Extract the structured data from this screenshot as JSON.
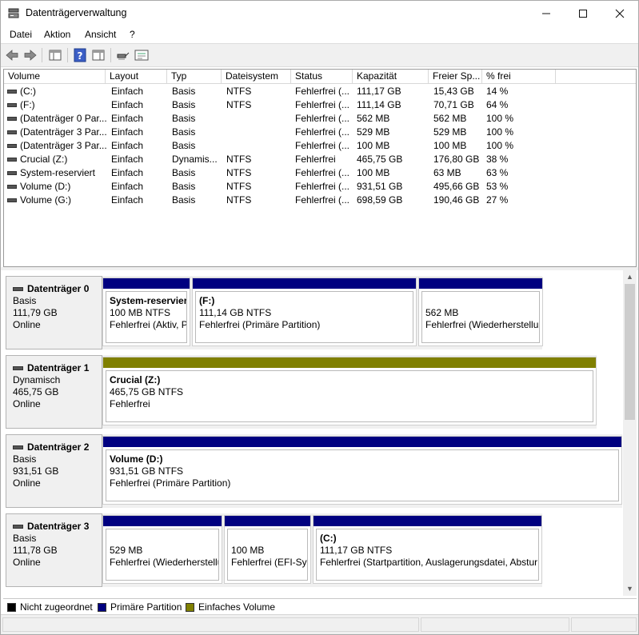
{
  "window": {
    "title": "Datenträgerverwaltung",
    "minimize": "—",
    "maximize": "☐",
    "close": "✕"
  },
  "menu": [
    "Datei",
    "Aktion",
    "Ansicht",
    "?"
  ],
  "toolbar": {
    "icons": [
      "back-arrow-icon",
      "forward-arrow-icon",
      "console-tree-icon",
      "help-icon",
      "details-pane-icon",
      "connect-icon",
      "properties-icon"
    ]
  },
  "volume_list": {
    "columns": [
      "Volume",
      "Layout",
      "Typ",
      "Dateisystem",
      "Status",
      "Kapazität",
      "Freier Sp...",
      "% frei"
    ],
    "rows": [
      [
        "(C:)",
        "Einfach",
        "Basis",
        "NTFS",
        "Fehlerfrei (...",
        "111,17 GB",
        "15,43 GB",
        "14 %"
      ],
      [
        "(F:)",
        "Einfach",
        "Basis",
        "NTFS",
        "Fehlerfrei (...",
        "111,14 GB",
        "70,71 GB",
        "64 %"
      ],
      [
        "(Datenträger 0 Par...",
        "Einfach",
        "Basis",
        "",
        "Fehlerfrei (...",
        "562 MB",
        "562 MB",
        "100 %"
      ],
      [
        "(Datenträger 3 Par...",
        "Einfach",
        "Basis",
        "",
        "Fehlerfrei (...",
        "529 MB",
        "529 MB",
        "100 %"
      ],
      [
        "(Datenträger 3 Par...",
        "Einfach",
        "Basis",
        "",
        "Fehlerfrei (...",
        "100 MB",
        "100 MB",
        "100 %"
      ],
      [
        "Crucial (Z:)",
        "Einfach",
        "Dynamis...",
        "NTFS",
        "Fehlerfrei",
        "465,75 GB",
        "176,80 GB",
        "38 %"
      ],
      [
        "System-reserviert",
        "Einfach",
        "Basis",
        "NTFS",
        "Fehlerfrei (...",
        "100 MB",
        "63 MB",
        "63 %"
      ],
      [
        "Volume (D:)",
        "Einfach",
        "Basis",
        "NTFS",
        "Fehlerfrei (...",
        "931,51 GB",
        "495,66 GB",
        "53 %"
      ],
      [
        "Volume (G:)",
        "Einfach",
        "Basis",
        "NTFS",
        "Fehlerfrei (...",
        "698,59 GB",
        "190,46 GB",
        "27 %"
      ]
    ]
  },
  "disks": [
    {
      "name": "Datenträger 0",
      "type": "Basis",
      "size": "111,79 GB",
      "state": "Online",
      "partitions": [
        {
          "name": "System-reservier",
          "fs": "100 MB NTFS",
          "status": "Fehlerfrei (Aktiv, P",
          "kind": "primary"
        },
        {
          "name": "(F:)",
          "fs": "111,14 GB NTFS",
          "status": "Fehlerfrei (Primäre Partition)",
          "kind": "primary"
        },
        {
          "name": "",
          "fs": "562 MB",
          "status": "Fehlerfrei (Wiederherstellu",
          "kind": "primary"
        }
      ]
    },
    {
      "name": "Datenträger 1",
      "type": "Dynamisch",
      "size": "465,75 GB",
      "state": "Online",
      "partitions": [
        {
          "name": "Crucial  (Z:)",
          "fs": "465,75 GB NTFS",
          "status": "Fehlerfrei",
          "kind": "simple"
        }
      ]
    },
    {
      "name": "Datenträger 2",
      "type": "Basis",
      "size": "931,51 GB",
      "state": "Online",
      "partitions": [
        {
          "name": "Volume  (D:)",
          "fs": "931,51 GB NTFS",
          "status": "Fehlerfrei (Primäre Partition)",
          "kind": "primary"
        }
      ]
    },
    {
      "name": "Datenträger 3",
      "type": "Basis",
      "size": "111,78 GB",
      "state": "Online",
      "partitions": [
        {
          "name": "",
          "fs": "529 MB",
          "status": "Fehlerfrei (Wiederherstellu",
          "kind": "primary"
        },
        {
          "name": "",
          "fs": "100 MB",
          "status": "Fehlerfrei (EFI-Syst",
          "kind": "primary"
        },
        {
          "name": "(C:)",
          "fs": "111,17 GB NTFS",
          "status": "Fehlerfrei (Startpartition, Auslagerungsdatei, Abstur",
          "kind": "primary"
        }
      ]
    }
  ],
  "legend": [
    {
      "label": "Nicht zugeordnet",
      "color": "#000000"
    },
    {
      "label": "Primäre Partition",
      "color": "#000080"
    },
    {
      "label": "Einfaches Volume",
      "color": "#808000"
    }
  ],
  "colors": {
    "primary": "#000080",
    "simple": "#808000",
    "unallocated": "#000000"
  }
}
